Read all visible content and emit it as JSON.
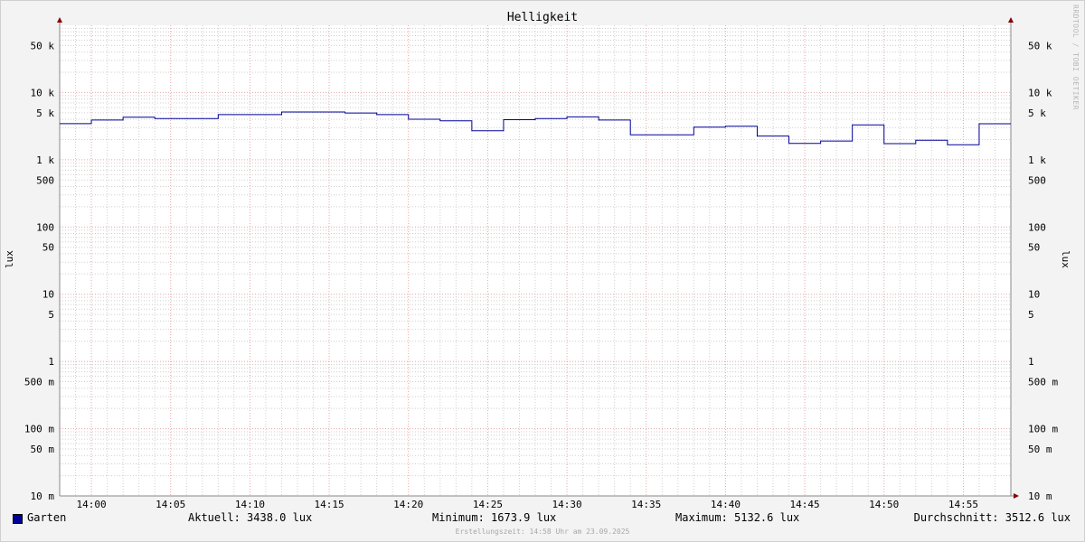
{
  "chart_data": {
    "type": "line",
    "title": "Helligkeit",
    "ylabel": "lux",
    "y_scale": "log",
    "ylim": [
      0.01,
      100000
    ],
    "y_ticks": [
      {
        "value": 50000,
        "label": "50 k"
      },
      {
        "value": 10000,
        "label": "10 k"
      },
      {
        "value": 5000,
        "label": "5 k"
      },
      {
        "value": 1000,
        "label": "1 k"
      },
      {
        "value": 500,
        "label": "500"
      },
      {
        "value": 100,
        "label": "100"
      },
      {
        "value": 50,
        "label": "50"
      },
      {
        "value": 10,
        "label": "10"
      },
      {
        "value": 5,
        "label": "5"
      },
      {
        "value": 1,
        "label": "1"
      },
      {
        "value": 0.5,
        "label": "500 m"
      },
      {
        "value": 0.1,
        "label": "100 m"
      },
      {
        "value": 0.05,
        "label": "50 m"
      },
      {
        "value": 0.01,
        "label": "10 m"
      }
    ],
    "xlim": [
      "13:58",
      "14:58"
    ],
    "x_ticks": [
      "14:00",
      "14:05",
      "14:10",
      "14:15",
      "14:20",
      "14:25",
      "14:30",
      "14:35",
      "14:40",
      "14:45",
      "14:50",
      "14:55"
    ],
    "grid": true,
    "series": [
      {
        "name": "Garten",
        "color": "#000099",
        "step": true,
        "points": [
          {
            "x": "13:58",
            "y": 3440
          },
          {
            "x": "14:00",
            "y": 3900
          },
          {
            "x": "14:02",
            "y": 4300
          },
          {
            "x": "14:04",
            "y": 4100
          },
          {
            "x": "14:08",
            "y": 4700
          },
          {
            "x": "14:12",
            "y": 5133
          },
          {
            "x": "14:16",
            "y": 4950
          },
          {
            "x": "14:18",
            "y": 4700
          },
          {
            "x": "14:20",
            "y": 4000
          },
          {
            "x": "14:22",
            "y": 3800
          },
          {
            "x": "14:24",
            "y": 2700
          },
          {
            "x": "14:26",
            "y": 3950
          },
          {
            "x": "14:28",
            "y": 4100
          },
          {
            "x": "14:30",
            "y": 4350
          },
          {
            "x": "14:32",
            "y": 3900
          },
          {
            "x": "14:34",
            "y": 2350
          },
          {
            "x": "14:38",
            "y": 3050
          },
          {
            "x": "14:40",
            "y": 3150
          },
          {
            "x": "14:42",
            "y": 2250
          },
          {
            "x": "14:44",
            "y": 1750
          },
          {
            "x": "14:46",
            "y": 1900
          },
          {
            "x": "14:48",
            "y": 3300
          },
          {
            "x": "14:50",
            "y": 1740
          },
          {
            "x": "14:52",
            "y": 1950
          },
          {
            "x": "14:54",
            "y": 1674
          },
          {
            "x": "14:56",
            "y": 3438
          },
          {
            "x": "14:58",
            "y": 3438
          }
        ]
      }
    ]
  },
  "legend": {
    "series_name": "Garten",
    "current": "Aktuell: 3438.0 lux",
    "minimum": "Minimum: 1673.9 lux",
    "maximum": "Maximum: 5132.6 lux",
    "average": "Durchschnitt: 3512.6 lux"
  },
  "footer": "Erstellungszeit: 14:58 Uhr am 23.09.2025",
  "watermark": "RRDTOOL / TOBI OETIKER",
  "colors": {
    "series": "#000099",
    "major_grid": "#e8a4a4",
    "minor_grid": "#cfcfcf",
    "background": "#f3f3f3",
    "plot_background": "#ffffff",
    "axis": "#888888",
    "arrow": "#880000"
  }
}
